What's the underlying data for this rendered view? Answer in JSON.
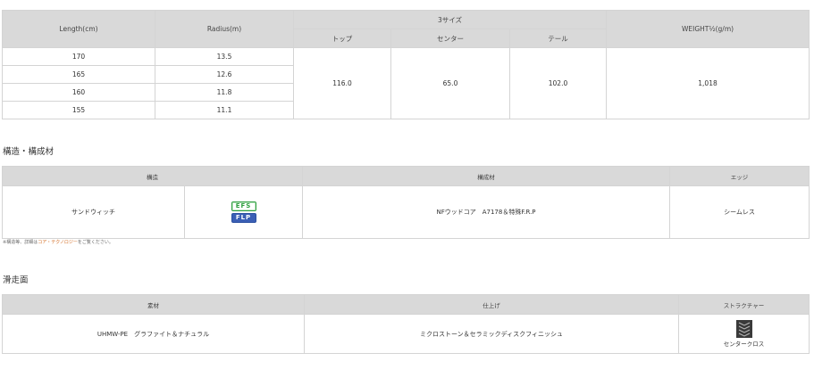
{
  "spec": {
    "headers": {
      "length": "Length(cm)",
      "radius": "Radius(m)",
      "three_size": "3サイズ",
      "top": "トップ",
      "center": "センター",
      "tail": "テール",
      "weight": "WEIGHT½(g/m)"
    },
    "rows": [
      {
        "length": "170",
        "radius": "13.5"
      },
      {
        "length": "165",
        "radius": "12.6"
      },
      {
        "length": "160",
        "radius": "11.8"
      },
      {
        "length": "155",
        "radius": "11.1"
      }
    ],
    "top": "116.0",
    "center": "65.0",
    "tail": "102.0",
    "weight": "1,018"
  },
  "structure_section": {
    "title": "構造・構成材",
    "headers": {
      "structure": "構造",
      "material": "構成材",
      "edge": "エッジ"
    },
    "structure": "サンドウィッチ",
    "badges": [
      "EFS",
      "FLP"
    ],
    "material": "NFウッドコア　A7178＆特殊F.R.P",
    "edge": "シームレス",
    "note_prefix": "※構造等、詳細は",
    "note_link": "コア・テクノロジー",
    "note_suffix": "をご覧ください。"
  },
  "base_section": {
    "title": "滑走面",
    "headers": {
      "material": "素材",
      "finish": "仕上げ",
      "structure": "ストラクチャー"
    },
    "material": "UHMW-PE　グラファイト＆ナチュラル",
    "finish": "ミクロストーン＆セラミックディスクフィニッシュ",
    "structure": "センタークロス",
    "structure_icon": "center-cross-icon"
  }
}
